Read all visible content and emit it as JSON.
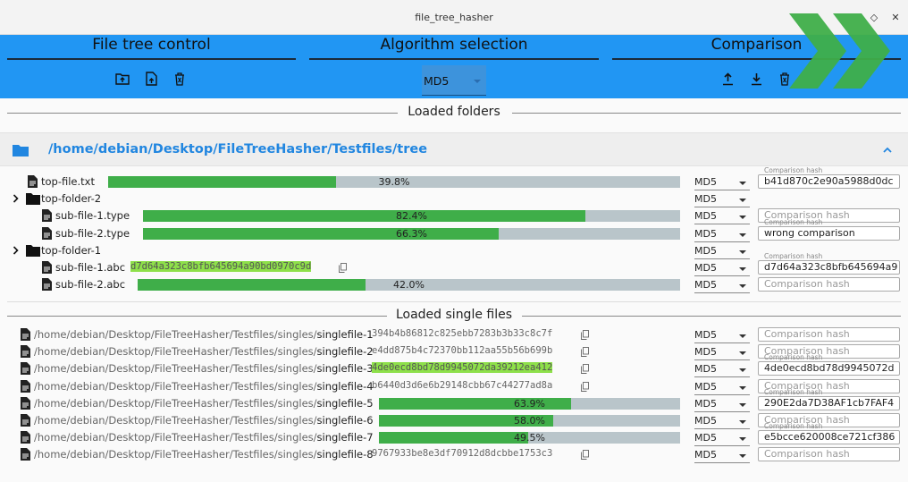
{
  "window": {
    "title": "file_tree_hasher",
    "restore_glyph": "◇",
    "close_glyph": "✕"
  },
  "header": {
    "file_tree_title": "File tree control",
    "algorithm_title": "Algorithm selection",
    "comparison_title": "Comparison",
    "algorithm_value": "MD5",
    "icons": [
      "folder-upload-icon",
      "file-upload-icon",
      "delete-icon",
      "export-icon",
      "import-icon",
      "delete-comparison-icon"
    ]
  },
  "folders_section": {
    "title": "Loaded folders"
  },
  "singles_section": {
    "title": "Loaded single files"
  },
  "folder": {
    "path": "/home/debian/Desktop/FileTreeHasher/Testfiles/tree"
  },
  "tree_rows": [
    {
      "name": "top-file.txt",
      "type": "file",
      "progress": 39.8,
      "progress_label": "39.8%",
      "algo": "MD5",
      "comparison_label": "Comparison hash",
      "comparison_value": "b41d870c2e90a5988d0dc",
      "comparison_placeholder": ""
    },
    {
      "name": "top-folder-2",
      "type": "folder",
      "algo": "MD5"
    },
    {
      "name": "sub-file-1.type",
      "type": "file",
      "progress": 82.4,
      "progress_label": "82.4%",
      "algo": "MD5",
      "comparison_label": "",
      "comparison_value": "",
      "comparison_placeholder": "Comparison hash"
    },
    {
      "name": "sub-file-2.type",
      "type": "file",
      "progress": 66.3,
      "progress_label": "66.3%",
      "algo": "MD5",
      "comparison_label": "Comparison hash",
      "comparison_value": "wrong comparison",
      "comparison_placeholder": ""
    },
    {
      "name": "top-folder-1",
      "type": "folder",
      "algo": "MD5"
    },
    {
      "name": "sub-file-1.abc",
      "type": "file",
      "hash": "d7d64a323c8bfb645694a90bd0970c9d",
      "match": true,
      "algo": "MD5",
      "comparison_label": "Comparison hash",
      "comparison_value": "d7d64a323c8bfb645694a9",
      "comparison_placeholder": ""
    },
    {
      "name": "sub-file-2.abc",
      "type": "file",
      "progress": 42.0,
      "progress_label": "42.0%",
      "algo": "MD5",
      "comparison_label": "",
      "comparison_value": "",
      "comparison_placeholder": "Comparison hash"
    }
  ],
  "single_rows": [
    {
      "path": "/home/debian/Desktop/FileTreeHasher/Testfiles/singles/",
      "name": "singlefile-1",
      "hash": "394b4b86812c825ebb7283b3b33c8c7f",
      "match": false,
      "algo": "MD5",
      "comparison_label": "",
      "comparison_value": "",
      "comparison_placeholder": "Comparison hash"
    },
    {
      "path": "/home/debian/Desktop/FileTreeHasher/Testfiles/singles/",
      "name": "singlefile-2",
      "hash": "e4dd875b4c72370bb112aa55b56b699b",
      "match": false,
      "algo": "MD5",
      "comparison_label": "",
      "comparison_value": "",
      "comparison_placeholder": "Comparison hash"
    },
    {
      "path": "/home/debian/Desktop/FileTreeHasher/Testfiles/singles/",
      "name": "singlefile-3",
      "hash": "4de0ecd8bd78d9945072da39212ea412",
      "match": true,
      "algo": "MD5",
      "comparison_label": "Comparison hash",
      "comparison_value": "4de0ecd8bd78d9945072d",
      "comparison_placeholder": ""
    },
    {
      "path": "/home/debian/Desktop/FileTreeHasher/Testfiles/singles/",
      "name": "singlefile-4",
      "hash": "b6440d3d6e6b29148cbb67c44277ad8a",
      "match": false,
      "algo": "MD5",
      "comparison_label": "",
      "comparison_value": "",
      "comparison_placeholder": "Comparison hash"
    },
    {
      "path": "/home/debian/Desktop/FileTreeHasher/Testfiles/singles/",
      "name": "singlefile-5",
      "progress": 63.9,
      "progress_label": "63.9%",
      "algo": "MD5",
      "comparison_label": "Comparison hash",
      "comparison_value": "290E2da7D38AF1cb7FAF4",
      "comparison_placeholder": ""
    },
    {
      "path": "/home/debian/Desktop/FileTreeHasher/Testfiles/singles/",
      "name": "singlefile-6",
      "progress": 58.0,
      "progress_label": "58.0%",
      "algo": "MD5",
      "comparison_label": "",
      "comparison_value": "",
      "comparison_placeholder": "Comparison hash"
    },
    {
      "path": "/home/debian/Desktop/FileTreeHasher/Testfiles/singles/",
      "name": "singlefile-7",
      "progress": 49.5,
      "progress_label": "49.5%",
      "algo": "MD5",
      "comparison_label": "Comparison hash",
      "comparison_value": "e5bcce620008ce721cf386",
      "comparison_placeholder": ""
    },
    {
      "path": "/home/debian/Desktop/FileTreeHasher/Testfiles/singles/",
      "name": "singlefile-8",
      "hash": "9767933be8e3df70912d8dcbbe1753c3",
      "match": false,
      "algo": "MD5",
      "comparison_label": "",
      "comparison_value": "",
      "comparison_placeholder": "Comparison hash"
    }
  ],
  "colors": {
    "accent": "#2196f3",
    "progress": "#3fae49",
    "match": "#8ee04a",
    "folder_path": "#2186e0",
    "logo": "#3fae49"
  }
}
